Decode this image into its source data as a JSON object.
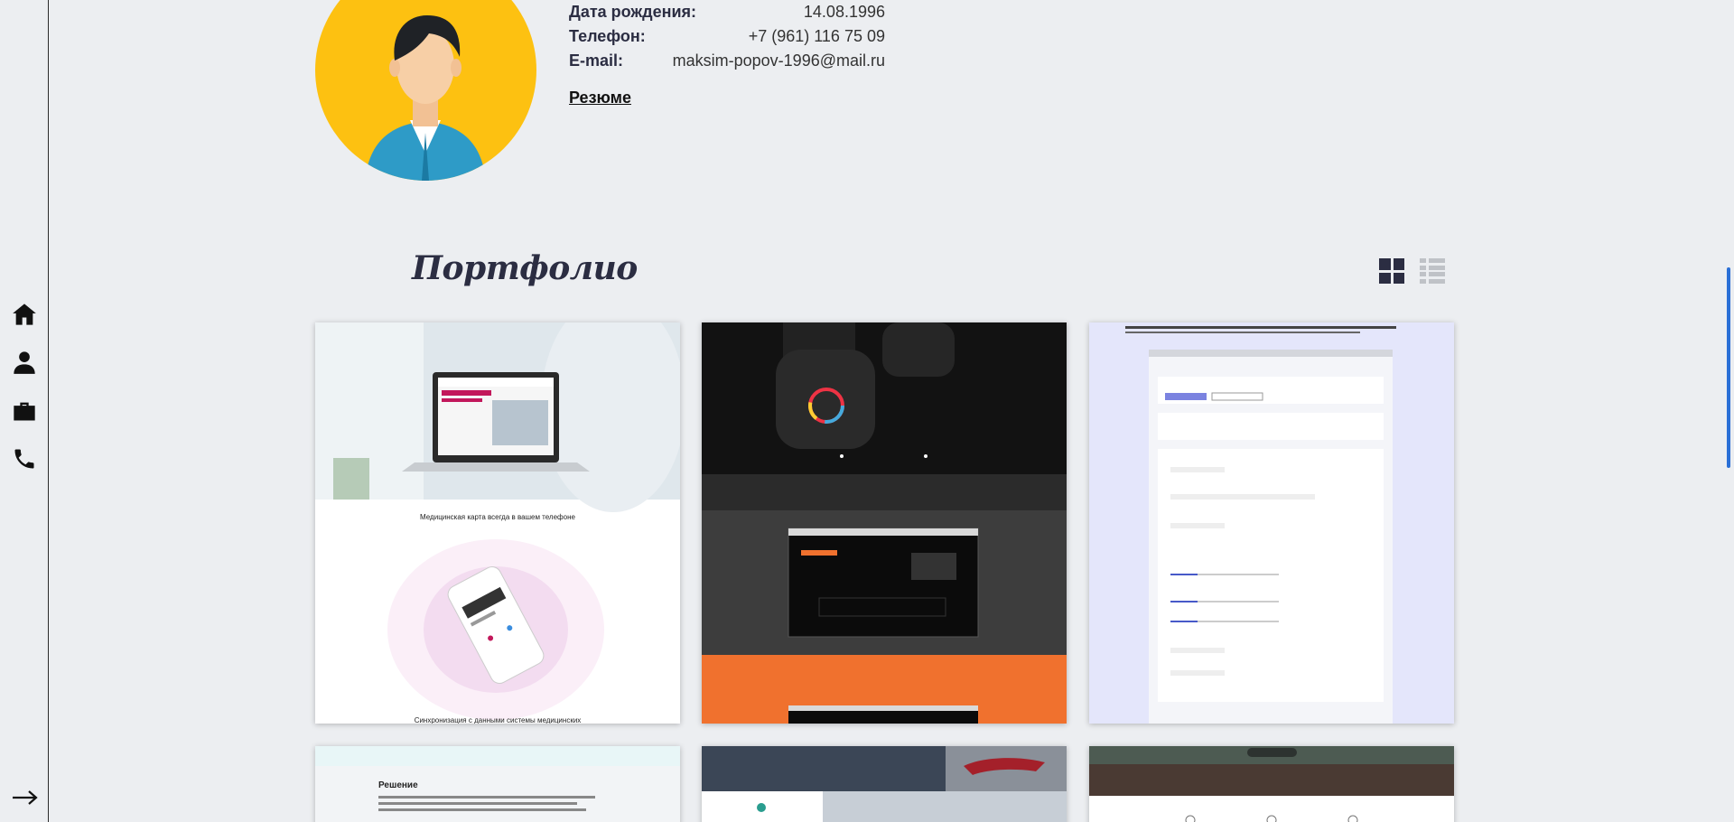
{
  "nav": {
    "items": [
      {
        "name": "home",
        "icon": "home-icon"
      },
      {
        "name": "about",
        "icon": "user-icon"
      },
      {
        "name": "portfolio",
        "icon": "briefcase-icon"
      },
      {
        "name": "contacts",
        "icon": "phone-icon"
      }
    ],
    "exit_icon": "arrow-right-icon"
  },
  "profile": {
    "rows": [
      {
        "label": "Дата рождения:",
        "value": "14.08.1996"
      },
      {
        "label": "Телефон:",
        "value": "+7 (961) 116 75 09"
      },
      {
        "label": "E-mail:",
        "value": "maksim-popov-1996@mail.ru"
      }
    ],
    "resume_link": "Резюме",
    "avatar_color": "#fdc111"
  },
  "portfolio": {
    "title": "Портфолио",
    "view_grid_icon": "grid-view-icon",
    "view_list_icon": "list-view-icon",
    "cards": [
      {
        "caption": "Медицинская карта всегда в вашем телефоне",
        "footer": "Синхронизация с данными системы медицинских"
      },
      {
        "caption": ""
      },
      {
        "caption": ""
      },
      {
        "caption": "Решение"
      },
      {
        "caption": ""
      },
      {
        "caption": ""
      }
    ]
  },
  "colors": {
    "accent": "#2a6fd6",
    "dark": "#2b2d42",
    "orange": "#f0712e"
  }
}
